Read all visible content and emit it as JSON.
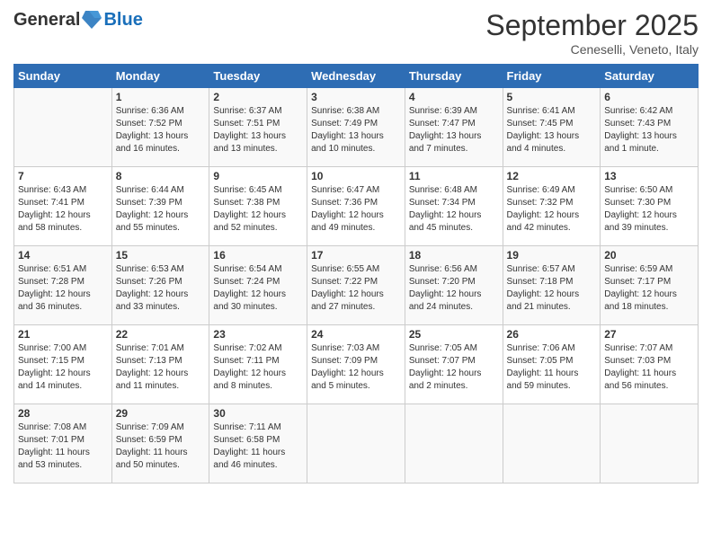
{
  "header": {
    "logo_general": "General",
    "logo_blue": "Blue",
    "title": "September 2025",
    "location": "Ceneselli, Veneto, Italy"
  },
  "days_of_week": [
    "Sunday",
    "Monday",
    "Tuesday",
    "Wednesday",
    "Thursday",
    "Friday",
    "Saturday"
  ],
  "weeks": [
    [
      {
        "day": "",
        "info": ""
      },
      {
        "day": "1",
        "info": "Sunrise: 6:36 AM\nSunset: 7:52 PM\nDaylight: 13 hours\nand 16 minutes."
      },
      {
        "day": "2",
        "info": "Sunrise: 6:37 AM\nSunset: 7:51 PM\nDaylight: 13 hours\nand 13 minutes."
      },
      {
        "day": "3",
        "info": "Sunrise: 6:38 AM\nSunset: 7:49 PM\nDaylight: 13 hours\nand 10 minutes."
      },
      {
        "day": "4",
        "info": "Sunrise: 6:39 AM\nSunset: 7:47 PM\nDaylight: 13 hours\nand 7 minutes."
      },
      {
        "day": "5",
        "info": "Sunrise: 6:41 AM\nSunset: 7:45 PM\nDaylight: 13 hours\nand 4 minutes."
      },
      {
        "day": "6",
        "info": "Sunrise: 6:42 AM\nSunset: 7:43 PM\nDaylight: 13 hours\nand 1 minute."
      }
    ],
    [
      {
        "day": "7",
        "info": "Sunrise: 6:43 AM\nSunset: 7:41 PM\nDaylight: 12 hours\nand 58 minutes."
      },
      {
        "day": "8",
        "info": "Sunrise: 6:44 AM\nSunset: 7:39 PM\nDaylight: 12 hours\nand 55 minutes."
      },
      {
        "day": "9",
        "info": "Sunrise: 6:45 AM\nSunset: 7:38 PM\nDaylight: 12 hours\nand 52 minutes."
      },
      {
        "day": "10",
        "info": "Sunrise: 6:47 AM\nSunset: 7:36 PM\nDaylight: 12 hours\nand 49 minutes."
      },
      {
        "day": "11",
        "info": "Sunrise: 6:48 AM\nSunset: 7:34 PM\nDaylight: 12 hours\nand 45 minutes."
      },
      {
        "day": "12",
        "info": "Sunrise: 6:49 AM\nSunset: 7:32 PM\nDaylight: 12 hours\nand 42 minutes."
      },
      {
        "day": "13",
        "info": "Sunrise: 6:50 AM\nSunset: 7:30 PM\nDaylight: 12 hours\nand 39 minutes."
      }
    ],
    [
      {
        "day": "14",
        "info": "Sunrise: 6:51 AM\nSunset: 7:28 PM\nDaylight: 12 hours\nand 36 minutes."
      },
      {
        "day": "15",
        "info": "Sunrise: 6:53 AM\nSunset: 7:26 PM\nDaylight: 12 hours\nand 33 minutes."
      },
      {
        "day": "16",
        "info": "Sunrise: 6:54 AM\nSunset: 7:24 PM\nDaylight: 12 hours\nand 30 minutes."
      },
      {
        "day": "17",
        "info": "Sunrise: 6:55 AM\nSunset: 7:22 PM\nDaylight: 12 hours\nand 27 minutes."
      },
      {
        "day": "18",
        "info": "Sunrise: 6:56 AM\nSunset: 7:20 PM\nDaylight: 12 hours\nand 24 minutes."
      },
      {
        "day": "19",
        "info": "Sunrise: 6:57 AM\nSunset: 7:18 PM\nDaylight: 12 hours\nand 21 minutes."
      },
      {
        "day": "20",
        "info": "Sunrise: 6:59 AM\nSunset: 7:17 PM\nDaylight: 12 hours\nand 18 minutes."
      }
    ],
    [
      {
        "day": "21",
        "info": "Sunrise: 7:00 AM\nSunset: 7:15 PM\nDaylight: 12 hours\nand 14 minutes."
      },
      {
        "day": "22",
        "info": "Sunrise: 7:01 AM\nSunset: 7:13 PM\nDaylight: 12 hours\nand 11 minutes."
      },
      {
        "day": "23",
        "info": "Sunrise: 7:02 AM\nSunset: 7:11 PM\nDaylight: 12 hours\nand 8 minutes."
      },
      {
        "day": "24",
        "info": "Sunrise: 7:03 AM\nSunset: 7:09 PM\nDaylight: 12 hours\nand 5 minutes."
      },
      {
        "day": "25",
        "info": "Sunrise: 7:05 AM\nSunset: 7:07 PM\nDaylight: 12 hours\nand 2 minutes."
      },
      {
        "day": "26",
        "info": "Sunrise: 7:06 AM\nSunset: 7:05 PM\nDaylight: 11 hours\nand 59 minutes."
      },
      {
        "day": "27",
        "info": "Sunrise: 7:07 AM\nSunset: 7:03 PM\nDaylight: 11 hours\nand 56 minutes."
      }
    ],
    [
      {
        "day": "28",
        "info": "Sunrise: 7:08 AM\nSunset: 7:01 PM\nDaylight: 11 hours\nand 53 minutes."
      },
      {
        "day": "29",
        "info": "Sunrise: 7:09 AM\nSunset: 6:59 PM\nDaylight: 11 hours\nand 50 minutes."
      },
      {
        "day": "30",
        "info": "Sunrise: 7:11 AM\nSunset: 6:58 PM\nDaylight: 11 hours\nand 46 minutes."
      },
      {
        "day": "",
        "info": ""
      },
      {
        "day": "",
        "info": ""
      },
      {
        "day": "",
        "info": ""
      },
      {
        "day": "",
        "info": ""
      }
    ]
  ]
}
